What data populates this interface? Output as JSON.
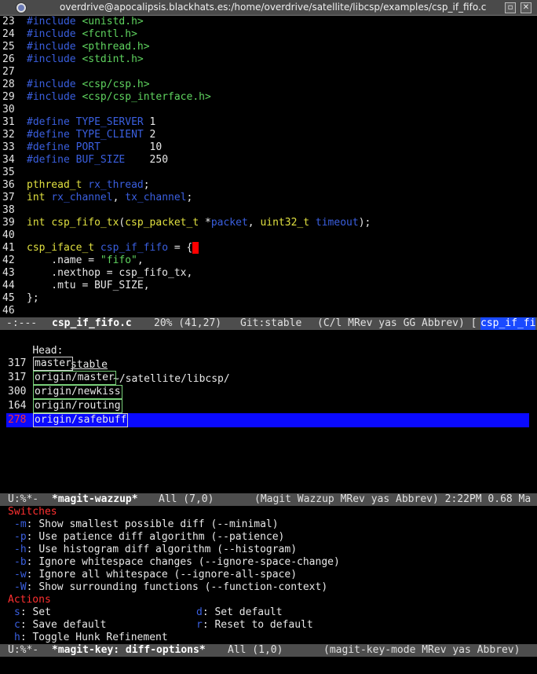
{
  "window": {
    "title": "overdrive@apocalipsis.blackhats.es:/home/overdrive/satellite/libcsp/examples/csp_if_fifo.c",
    "btn_min": "▫",
    "btn_close": "✕"
  },
  "code": {
    "lines": [
      {
        "n": "23",
        "segs": [
          [
            "pp",
            "#include "
          ],
          [
            "str",
            "<unistd.h>"
          ]
        ]
      },
      {
        "n": "24",
        "segs": [
          [
            "pp",
            "#include "
          ],
          [
            "str",
            "<fcntl.h>"
          ]
        ]
      },
      {
        "n": "25",
        "segs": [
          [
            "pp",
            "#include "
          ],
          [
            "str",
            "<pthread.h>"
          ]
        ]
      },
      {
        "n": "26",
        "segs": [
          [
            "pp",
            "#include "
          ],
          [
            "str",
            "<stdint.h>"
          ]
        ]
      },
      {
        "n": "27",
        "segs": []
      },
      {
        "n": "28",
        "segs": [
          [
            "pp",
            "#include "
          ],
          [
            "str",
            "<csp/csp.h>"
          ]
        ]
      },
      {
        "n": "29",
        "segs": [
          [
            "pp",
            "#include "
          ],
          [
            "str",
            "<csp/csp_interface.h>"
          ]
        ]
      },
      {
        "n": "30",
        "segs": []
      },
      {
        "n": "31",
        "segs": [
          [
            "pp",
            "#define "
          ],
          [
            "var",
            "TYPE_SERVER "
          ],
          [
            "num",
            "1"
          ]
        ]
      },
      {
        "n": "32",
        "segs": [
          [
            "pp",
            "#define "
          ],
          [
            "var",
            "TYPE_CLIENT "
          ],
          [
            "num",
            "2"
          ]
        ]
      },
      {
        "n": "33",
        "segs": [
          [
            "pp",
            "#define "
          ],
          [
            "var",
            "PORT        "
          ],
          [
            "num",
            "10"
          ]
        ]
      },
      {
        "n": "34",
        "segs": [
          [
            "pp",
            "#define "
          ],
          [
            "var",
            "BUF_SIZE    "
          ],
          [
            "num",
            "250"
          ]
        ]
      },
      {
        "n": "35",
        "segs": []
      },
      {
        "n": "36",
        "segs": [
          [
            "typ",
            "pthread_t "
          ],
          [
            "var",
            "rx_thread"
          ],
          [
            "num",
            ";"
          ]
        ]
      },
      {
        "n": "37",
        "segs": [
          [
            "typ",
            "int "
          ],
          [
            "var",
            "rx_channel"
          ],
          [
            "num",
            ", "
          ],
          [
            "var",
            "tx_channel"
          ],
          [
            "num",
            ";"
          ]
        ]
      },
      {
        "n": "38",
        "segs": []
      },
      {
        "n": "39",
        "segs": [
          [
            "typ",
            "int "
          ],
          [
            "typ",
            "csp_fifo_tx"
          ],
          [
            "num",
            "("
          ],
          [
            "typ",
            "csp_packet_t "
          ],
          [
            "num",
            "*"
          ],
          [
            "var",
            "packet"
          ],
          [
            "num",
            ", "
          ],
          [
            "typ",
            "uint32_t "
          ],
          [
            "var",
            "timeout"
          ],
          [
            "num",
            ");"
          ]
        ]
      },
      {
        "n": "40",
        "segs": []
      },
      {
        "n": "41",
        "segs": [
          [
            "typ",
            "csp_iface_t "
          ],
          [
            "var",
            "csp_if_fifo"
          ],
          [
            "num",
            " = {"
          ],
          [
            "cursor",
            " "
          ]
        ]
      },
      {
        "n": "42",
        "segs": [
          [
            "num",
            "    .name = "
          ],
          [
            "str",
            "\"fifo\""
          ],
          [
            "num",
            ","
          ]
        ]
      },
      {
        "n": "43",
        "segs": [
          [
            "num",
            "    .nexthop = csp_fifo_tx,"
          ]
        ]
      },
      {
        "n": "44",
        "segs": [
          [
            "num",
            "    .mtu = BUF_SIZE,"
          ]
        ]
      },
      {
        "n": "45",
        "segs": [
          [
            "num",
            "};"
          ]
        ]
      },
      {
        "n": "46",
        "segs": []
      }
    ]
  },
  "modeline1": {
    "status": "-:---",
    "buffer": "csp_if_fifo.c",
    "position": "20% (41,27)",
    "vc": "Git:stable",
    "modes": "(C/l MRev yas GG Abbrev) [",
    "tag": "csp_if_fi"
  },
  "magit": {
    "head_label": "Head:",
    "head_branch": "stable",
    "head_path": "~/satellite/libcsp/",
    "branches": [
      {
        "count": "317",
        "name": "master",
        "style": "bx"
      },
      {
        "count": "317",
        "name": "origin/master",
        "style": "bx-g"
      },
      {
        "count": "300",
        "name": "origin/newkiss",
        "style": "bx-g"
      },
      {
        "count": "164",
        "name": "origin/routing",
        "style": "bx-g"
      },
      {
        "count": "278",
        "name": "origin/safebuff",
        "style": "selected"
      }
    ]
  },
  "modeline2": {
    "status": "U:%*-",
    "buffer": "*magit-wazzup*",
    "position": "All (7,0)",
    "modes": "(Magit Wazzup MRev yas Abbrev) 2:22PM 0.68 Ma"
  },
  "keys": {
    "switches_title": "Switches",
    "switches": [
      {
        "key": "-m",
        "desc": "Show smallest possible diff (--minimal)"
      },
      {
        "key": "-p",
        "desc": "Use patience diff algorithm (--patience)"
      },
      {
        "key": "-h",
        "desc": "Use histogram diff algorithm (--histogram)"
      },
      {
        "key": "-b",
        "desc": "Ignore whitespace changes (--ignore-space-change)"
      },
      {
        "key": "-w",
        "desc": "Ignore all whitespace (--ignore-all-space)"
      },
      {
        "key": "-W",
        "desc": "Show surrounding functions (--function-context)"
      }
    ],
    "actions_title": "Actions",
    "actions": [
      {
        "key": "s",
        "desc": "Set",
        "key2": "d",
        "desc2": "Set default"
      },
      {
        "key": "c",
        "desc": "Save default",
        "key2": "r",
        "desc2": "Reset to default"
      },
      {
        "key": "h",
        "desc": "Toggle Hunk Refinement",
        "key2": "",
        "desc2": ""
      }
    ]
  },
  "modeline3": {
    "status": "U:%*-",
    "buffer": "*magit-key: diff-options*",
    "position": "All (1,0)",
    "modes": "(magit-key-mode MRev yas Abbrev)"
  },
  "colors": {
    "keyword": "#3a5fe0",
    "string": "#5fd35f",
    "type": "#e0e040",
    "selection": "#0a0aff",
    "section": "#ff3030"
  }
}
